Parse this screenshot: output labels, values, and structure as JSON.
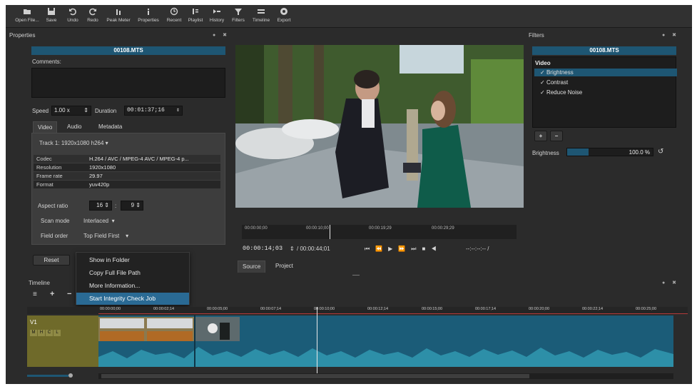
{
  "toolbar": {
    "items": [
      {
        "label": "Open File...",
        "icon": "folder-open-icon"
      },
      {
        "label": "Save",
        "icon": "save-icon"
      },
      {
        "label": "Undo",
        "icon": "undo-icon"
      },
      {
        "label": "Redo",
        "icon": "redo-icon"
      },
      {
        "label": "Peak Meter",
        "icon": "peak-meter-icon"
      },
      {
        "label": "Properties",
        "icon": "properties-icon"
      },
      {
        "label": "Recent",
        "icon": "clock-icon"
      },
      {
        "label": "Playlist",
        "icon": "playlist-icon"
      },
      {
        "label": "History",
        "icon": "history-icon"
      },
      {
        "label": "Filters",
        "icon": "filter-icon"
      },
      {
        "label": "Timeline",
        "icon": "timeline-icon"
      },
      {
        "label": "Export",
        "icon": "export-icon"
      }
    ]
  },
  "properties": {
    "title": "Properties",
    "dock_buttons": "● ✖",
    "file_name": "00108.MTS",
    "comments_label": "Comments:",
    "speed_label": "Speed",
    "speed_value": "1.00 x",
    "duration_label": "Duration",
    "duration_value": "00:01:37;16",
    "tabs": [
      "Video",
      "Audio",
      "Metadata"
    ],
    "track_value": "Track 1: 1920x1080 h264",
    "info": [
      {
        "key": "Codec",
        "value": "H.264 / AVC / MPEG-4 AVC / MPEG-4 p..."
      },
      {
        "key": "Resolution",
        "value": "1920x1080"
      },
      {
        "key": "Frame rate",
        "value": "29.97"
      },
      {
        "key": "Format",
        "value": "yuv420p"
      }
    ],
    "aspect_label": "Aspect ratio",
    "aspect_w": "16",
    "aspect_sep": ":",
    "aspect_h": "9",
    "scan_label": "Scan mode",
    "scan_value": "Interlaced",
    "field_label": "Field order",
    "field_value": "Top Field First",
    "reset_label": "Reset"
  },
  "context_menu": {
    "items": [
      "Show in Folder",
      "Copy Full File Path",
      "More Information...",
      "Start Integrity Check Job"
    ],
    "selected_index": 3
  },
  "player": {
    "ruler": [
      "00:00:00;00",
      "00:00:10;00",
      "00:00:19;29",
      "00:00:29;29"
    ],
    "current_time": "00:00:14;03",
    "total_time": "/ 00:00:44;01",
    "in_out": "--:--:--:-- /",
    "tabs": [
      "Source",
      "Project"
    ],
    "playhead_fraction": 0.32
  },
  "filters": {
    "title": "Filters",
    "dock_buttons": "● ✖",
    "file_name": "00108.MTS",
    "category": "Video",
    "items": [
      "Brightness",
      "Contrast",
      "Reduce Noise"
    ],
    "selected_index": 0,
    "add_label": "+",
    "remove_label": "−",
    "param_label": "Brightness",
    "param_value": "100.0 %",
    "param_fraction": 0.25
  },
  "timeline": {
    "title": "Timeline",
    "dock_buttons": "● ✖",
    "track_name": "V1",
    "track_buttons": [
      "M",
      "H",
      "C",
      "L"
    ],
    "ruler": [
      "00:00:00;00",
      "00:00:02;14",
      "00:00:05;00",
      "00:00:07;14",
      "00:00:10;00",
      "00:00:12;14",
      "00:00:15;00",
      "00:00:17;14",
      "00:00:20;00",
      "00:00:22;14",
      "00:00:25;00"
    ],
    "toolbar_buttons": [
      "≡",
      "+",
      "−"
    ]
  },
  "colors": {
    "accent": "#1e5673",
    "selection": "#2a6a94",
    "track_header": "#6f6a2a",
    "audio_wave": "#2d8fa8",
    "clip": "#1b5c78"
  }
}
